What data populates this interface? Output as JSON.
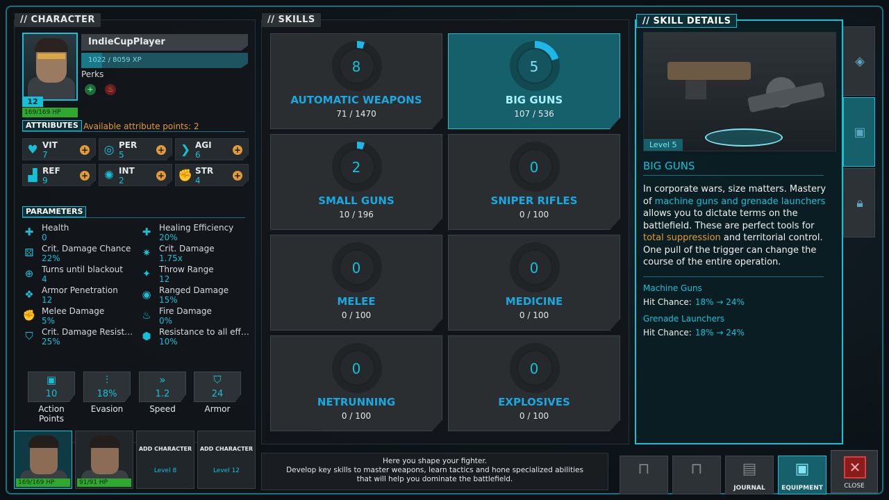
{
  "character_panel": {
    "title": "// CHARACTER",
    "name": "IndieCupPlayer",
    "xp": "1022 / 8059 XP",
    "xp_fraction": 0.127,
    "level": "12",
    "hp": "169/169 HP",
    "perks_label": "Perks"
  },
  "attributes": {
    "label": "ATTRIBUTES",
    "available": "Available attribute points: 2",
    "items": [
      {
        "name": "VIT",
        "value": "7",
        "icon": "heart-monitor-icon"
      },
      {
        "name": "PER",
        "value": "5",
        "icon": "goggles-icon"
      },
      {
        "name": "AGI",
        "value": "6",
        "icon": "wing-icon"
      },
      {
        "name": "REF",
        "value": "9",
        "icon": "boot-icon"
      },
      {
        "name": "INT",
        "value": "2",
        "icon": "brain-icon"
      },
      {
        "name": "STR",
        "value": "4",
        "icon": "arm-icon"
      }
    ]
  },
  "parameters": {
    "label": "PARAMETERS",
    "items": [
      {
        "name": "Health",
        "value": "0"
      },
      {
        "name": "Healing Efficiency",
        "value": "20%"
      },
      {
        "name": "Crit. Damage Chance",
        "value": "22%"
      },
      {
        "name": "Crit. Damage",
        "value": "1.75x"
      },
      {
        "name": "Turns until blackout",
        "value": "4"
      },
      {
        "name": "Throw Range",
        "value": "12"
      },
      {
        "name": "Armor Penetration",
        "value": "12"
      },
      {
        "name": "Ranged Damage",
        "value": "15%"
      },
      {
        "name": "Melee Damage",
        "value": "5%"
      },
      {
        "name": "Fire Damage",
        "value": "0%"
      },
      {
        "name": "Crit. Damage Resist…",
        "value": "25%"
      },
      {
        "name": "Resistance to all eff…",
        "value": "10%"
      }
    ]
  },
  "stats": [
    {
      "label": "Action Points",
      "value": "10"
    },
    {
      "label": "Evasion",
      "value": "18%"
    },
    {
      "label": "Speed",
      "value": "1.2"
    },
    {
      "label": "Armor",
      "value": "24"
    }
  ],
  "party": [
    {
      "hp": "169/169 HP"
    },
    {
      "hp": "91/91 HP"
    },
    {
      "add_title": "ADD CHARACTER",
      "level": "Level 8"
    },
    {
      "add_title": "ADD CHARACTER",
      "level": "Level 12"
    }
  ],
  "skills_panel": {
    "title": "// SKILLS",
    "skills": [
      {
        "name": "AUTOMATIC WEAPONS",
        "level": "8",
        "xp": "71 / 1470",
        "progress": 0.05
      },
      {
        "name": "BIG GUNS",
        "level": "5",
        "xp": "107 / 536",
        "progress": 0.2
      },
      {
        "name": "SMALL GUNS",
        "level": "2",
        "xp": "10 / 196",
        "progress": 0.05
      },
      {
        "name": "SNIPER RIFLES",
        "level": "0",
        "xp": "0 / 100",
        "progress": 0
      },
      {
        "name": "MELEE",
        "level": "0",
        "xp": "0 / 100",
        "progress": 0
      },
      {
        "name": "MEDICINE",
        "level": "0",
        "xp": "0 / 100",
        "progress": 0
      },
      {
        "name": "NETRUNNING",
        "level": "0",
        "xp": "0 / 100",
        "progress": 0
      },
      {
        "name": "EXPLOSIVES",
        "level": "0",
        "xp": "0 / 100",
        "progress": 0
      }
    ],
    "hint_line1": "Here you shape your fighter.",
    "hint_line2": "Develop key skills to master weapons, learn tactics and hone specialized abilities",
    "hint_line3": "that will help you dominate the battlefield."
  },
  "details_panel": {
    "title": "// SKILL DETAILS",
    "image_level": "Level 5",
    "skill_name": "BIG GUNS",
    "desc_1": "In corporate wars, size matters. Mastery of ",
    "desc_hl1": "machine guns and grenade launchers",
    "desc_2": " allows you to dictate terms on the battlefield. These are perfect tools for ",
    "desc_hl2": "total suppression",
    "desc_3": " and territorial control. One pull of the trigger can change the course of the entire operation.",
    "sub1_title": "Machine Guns",
    "sub1_label": "Hit Chance:",
    "sub1_value": "18% → 24%",
    "sub2_title": "Grenade Launchers",
    "sub2_label": "Hit Chance:",
    "sub2_value": "18% → 24%"
  },
  "nav": {
    "journal": "JOURNAL",
    "equipment": "EQUIPMENT",
    "close": "CLOSE"
  },
  "colors": {
    "accent": "#16c1d8",
    "warning": "#e29b3a",
    "hp": "#2ea82e"
  }
}
